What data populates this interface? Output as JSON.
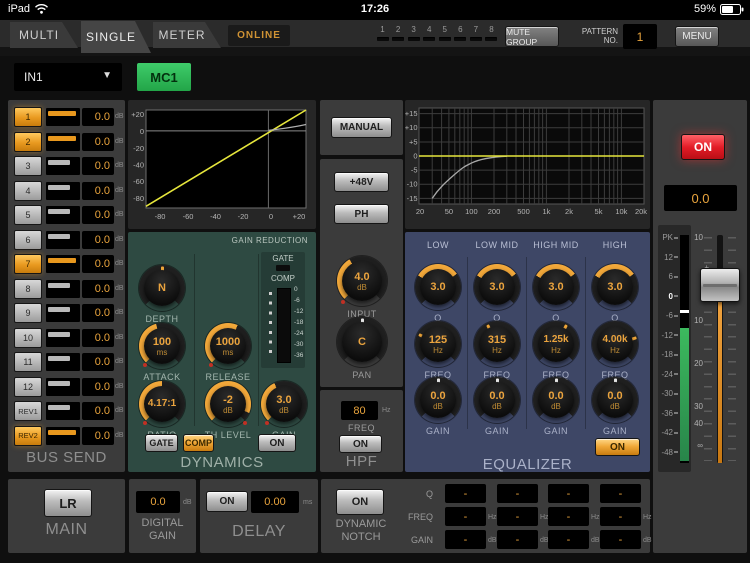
{
  "status_bar": {
    "device": "iPad",
    "time": "17:26",
    "battery": "59%"
  },
  "tab_bar": {
    "tabs": [
      {
        "label": "MULTI"
      },
      {
        "label": "SINGLE"
      },
      {
        "label": "METER"
      }
    ],
    "online": "ONLINE",
    "mute_indicators": [
      "1",
      "2",
      "3",
      "4",
      "5",
      "6",
      "7",
      "8"
    ],
    "mute_group": "MUTE GROUP",
    "pattern_label_1": "PATTERN",
    "pattern_label_2": "NO.",
    "pattern_value": "1",
    "menu": "MENU"
  },
  "channel": {
    "input": "IN1",
    "name": "MC1"
  },
  "bus_send": {
    "title": "BUS SEND",
    "unit": "dB",
    "rows": [
      {
        "label": "1",
        "value": "0.0",
        "on": true
      },
      {
        "label": "2",
        "value": "0.0",
        "on": true
      },
      {
        "label": "3",
        "value": "0.0",
        "on": false
      },
      {
        "label": "4",
        "value": "0.0",
        "on": false
      },
      {
        "label": "5",
        "value": "0.0",
        "on": false
      },
      {
        "label": "6",
        "value": "0.0",
        "on": false
      },
      {
        "label": "7",
        "value": "0.0",
        "on": true
      },
      {
        "label": "8",
        "value": "0.0",
        "on": false
      },
      {
        "label": "9",
        "value": "0.0",
        "on": false
      },
      {
        "label": "10",
        "value": "0.0",
        "on": false
      },
      {
        "label": "11",
        "value": "0.0",
        "on": false
      },
      {
        "label": "12",
        "value": "0.0",
        "on": false
      },
      {
        "label": "REV1",
        "value": "0.0",
        "on": false
      },
      {
        "label": "REV2",
        "value": "0.0",
        "on": true
      }
    ]
  },
  "dynamics": {
    "title": "DYNAMICS",
    "graph": {
      "y_ticks": [
        "+20",
        "0",
        "-20",
        "-40",
        "-60",
        "-80"
      ],
      "x_ticks": [
        "-80",
        "-60",
        "-40",
        "-20",
        "0",
        "+20"
      ]
    },
    "gain_reduction_label": "GAIN REDUCTION",
    "gate_label": "GATE",
    "comp_label": "COMP",
    "meter_scale": [
      "0",
      "-6",
      "-12",
      "-18",
      "-24",
      "-30",
      "-36"
    ],
    "knobs": {
      "depth": {
        "label": "DEPTH",
        "value": "N"
      },
      "attack": {
        "label": "ATTACK",
        "value": "100",
        "unit": "ms"
      },
      "release": {
        "label": "RELEASE",
        "value": "1000",
        "unit": "ms"
      },
      "ratio": {
        "label": "RATIO",
        "value": "4.17:1"
      },
      "th_level": {
        "label": "TH LEVEL",
        "value": "-2",
        "unit": "dB"
      },
      "gain": {
        "label": "GAIN",
        "value": "3.0",
        "unit": "dB"
      }
    },
    "buttons": {
      "gate": "GATE",
      "comp": "COMP",
      "on": "ON"
    }
  },
  "input_section": {
    "manual": "MANUAL",
    "phantom": "+48V",
    "phase": "PH",
    "input_knob": {
      "label": "INPUT",
      "value": "4.0",
      "unit": "dB"
    },
    "pan_knob": {
      "label": "PAN",
      "value": "C"
    }
  },
  "hpf": {
    "title": "HPF",
    "freq_value": "80",
    "freq_unit": "Hz",
    "freq_label": "FREQ",
    "on": "ON"
  },
  "equalizer": {
    "title": "EQUALIZER",
    "on": "ON",
    "knob_labels": {
      "q": "Q",
      "freq": "FREQ",
      "gain": "GAIN"
    },
    "graph": {
      "y_ticks": [
        "+15",
        "+10",
        "+5",
        "0",
        "-5",
        "-10",
        "-15"
      ],
      "x_ticks": [
        "20",
        "50",
        "100",
        "200",
        "500",
        "1k",
        "2k",
        "5k",
        "10k",
        "20k"
      ]
    },
    "bands": [
      {
        "name": "LOW",
        "q": "3.0",
        "freq": "125",
        "freq_unit": "Hz",
        "gain": "0.0",
        "gain_unit": "dB"
      },
      {
        "name": "LOW MID",
        "q": "3.0",
        "freq": "315",
        "freq_unit": "Hz",
        "gain": "0.0",
        "gain_unit": "dB"
      },
      {
        "name": "HIGH MID",
        "q": "3.0",
        "freq": "1.25k",
        "freq_unit": "Hz",
        "gain": "0.0",
        "gain_unit": "dB"
      },
      {
        "name": "HIGH",
        "q": "3.0",
        "freq": "4.00k",
        "freq_unit": "Hz",
        "gain": "0.0",
        "gain_unit": "dB"
      }
    ]
  },
  "output": {
    "on": "ON",
    "level": "0.0",
    "meter_scale": [
      "PK",
      "12",
      "6",
      "0",
      "-6",
      "-12",
      "-18",
      "-24",
      "-30",
      "-36",
      "-42",
      "-48"
    ],
    "fader_scale": [
      "10",
      "+",
      "0",
      "-",
      "10",
      "20",
      "30",
      "40",
      "∞"
    ]
  },
  "main_out": {
    "title": "MAIN",
    "button": "LR"
  },
  "digital_gain": {
    "title_1": "DIGITAL",
    "title_2": "GAIN",
    "value": "0.0",
    "unit": "dB"
  },
  "delay": {
    "title": "DELAY",
    "on": "ON",
    "value": "0.00",
    "unit": "ms"
  },
  "dynamic_notch": {
    "on": "ON",
    "title_1": "DYNAMIC",
    "title_2": "NOTCH",
    "rows": [
      {
        "label": "Q",
        "values": [
          "-",
          "-",
          "-",
          "-"
        ],
        "unit": ""
      },
      {
        "label": "FREQ",
        "values": [
          "-",
          "-",
          "-",
          "-"
        ],
        "unit": "Hz"
      },
      {
        "label": "GAIN",
        "values": [
          "-",
          "-",
          "-",
          "-"
        ],
        "unit": "dB"
      }
    ]
  },
  "colors": {
    "accent_orange": "#e9a43d",
    "button_orange": "#f0a838",
    "channel_green": "#2eb457",
    "on_red": "#e21b26",
    "meter_green": "#2f9e4e",
    "fader_orange": "#dc8a1e",
    "graph_yellow": "#e6e63c",
    "dynamics_bg": "#2e4a42",
    "equalizer_bg": "#3e4766"
  }
}
